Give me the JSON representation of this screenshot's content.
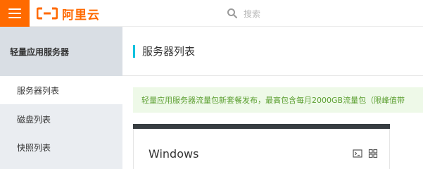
{
  "header": {
    "logo_text": "阿里云",
    "search_placeholder": "搜索",
    "accent_color": "#ff6a00",
    "icons": [
      "menu-icon",
      "aliyun-logo-icon",
      "search-icon"
    ]
  },
  "sidebar": {
    "title": "轻量应用服务器",
    "items": [
      {
        "label": "服务器列表",
        "active": true
      },
      {
        "label": "磁盘列表",
        "active": false
      },
      {
        "label": "快照列表",
        "active": false
      }
    ]
  },
  "main": {
    "page_title": "服务器列表",
    "notice": "轻量应用服务器流量包新套餐发布，最高包含每月2000GB流量包（限峰值带",
    "card": {
      "title": "Windows",
      "icons": [
        "terminal-icon",
        "grid-icon"
      ]
    }
  }
}
